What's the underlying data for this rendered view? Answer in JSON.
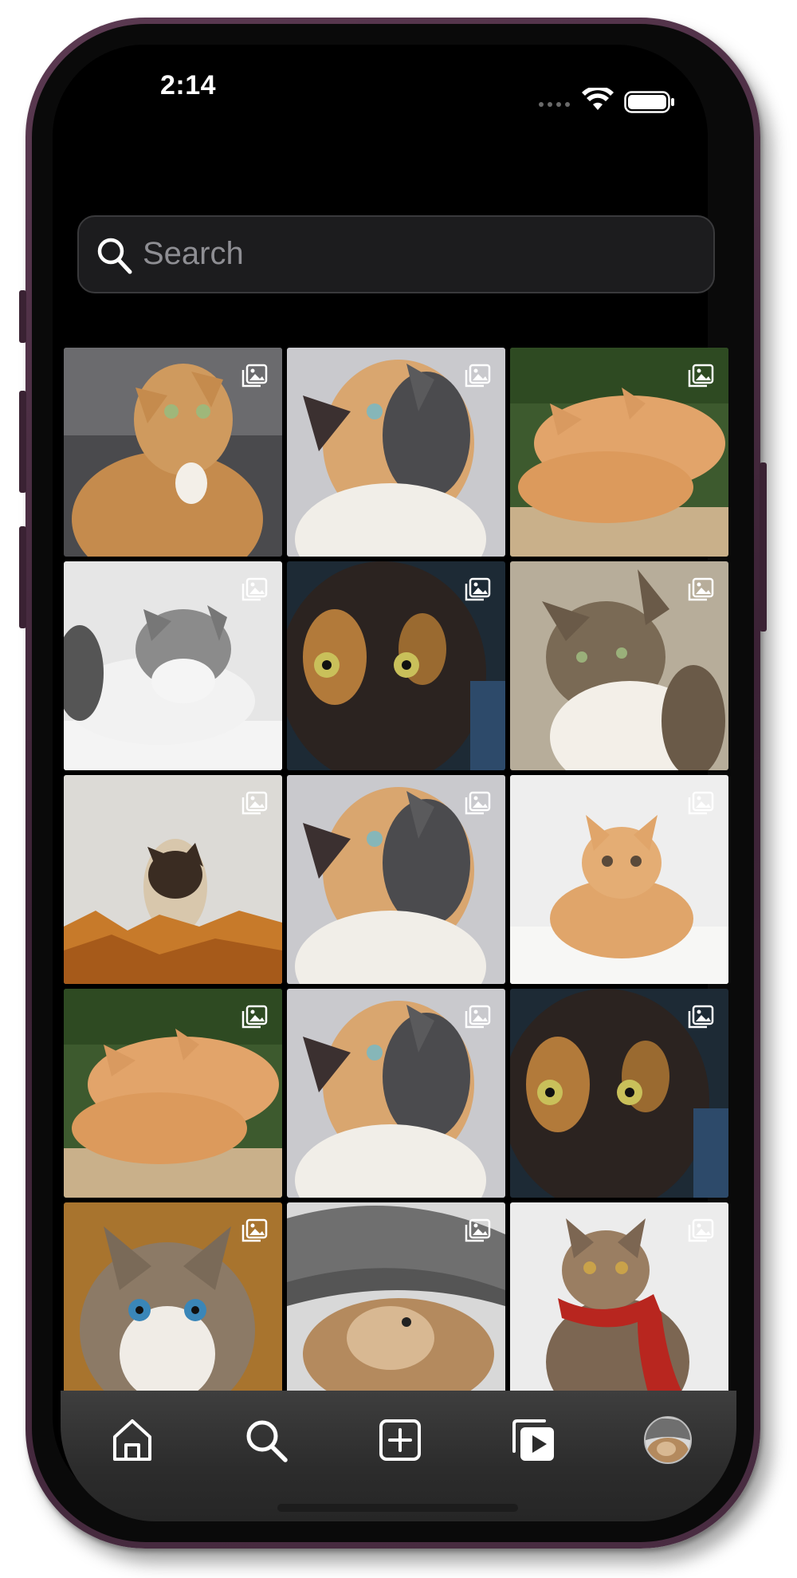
{
  "status_bar": {
    "time": "2:14",
    "icons": [
      "signal-dots-icon",
      "wifi-icon",
      "battery-icon"
    ]
  },
  "search": {
    "placeholder": "Search",
    "icon": "search-icon"
  },
  "explore_grid": {
    "tile_icon": "multiple-photos-icon",
    "tiles": [
      {
        "subject": "orange-cat-looking-up"
      },
      {
        "subject": "calico-cat-looking-up"
      },
      {
        "subject": "orange-kittens-sleeping"
      },
      {
        "subject": "gray-tabby-cat-sleeping"
      },
      {
        "subject": "tortoiseshell-cat-face"
      },
      {
        "subject": "tabby-cat-profile"
      },
      {
        "subject": "siamese-kitten-in-leaves"
      },
      {
        "subject": "calico-cat-looking-up"
      },
      {
        "subject": "orange-kitten-lying"
      },
      {
        "subject": "orange-kittens-sleeping"
      },
      {
        "subject": "calico-cat-looking-up"
      },
      {
        "subject": "tortoiseshell-cat-face"
      },
      {
        "subject": "blue-eyed-cat"
      },
      {
        "subject": "cat-under-knit-hat"
      },
      {
        "subject": "tabby-cat-red-scarf"
      }
    ]
  },
  "tab_bar": {
    "tabs": [
      {
        "icon": "home-icon",
        "active": true
      },
      {
        "icon": "search-icon",
        "active": false
      },
      {
        "icon": "create-post-icon",
        "active": false
      },
      {
        "icon": "reels-icon",
        "active": false
      },
      {
        "icon": "profile-avatar",
        "active": false
      }
    ]
  },
  "colors": {
    "background": "#000000",
    "search_field": "#1c1c1e",
    "placeholder": "#8e8e93",
    "tab_bar": "#2c2c2c",
    "frame": "#4a2d42"
  }
}
